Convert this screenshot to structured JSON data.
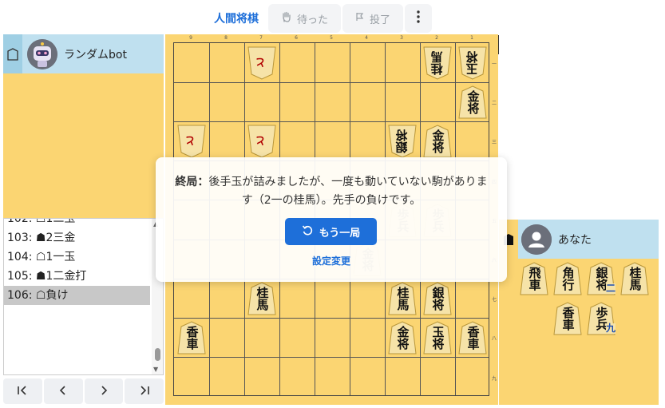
{
  "header": {
    "mode_title": "人間将棋",
    "undo_label": "待った",
    "resign_label": "投了",
    "menu_icon": "more-vertical-icon"
  },
  "opponent": {
    "name": "ランダムbot",
    "turn_icon": "gote-turn-icon",
    "avatar_icon": "robot-avatar-icon"
  },
  "player": {
    "name": "あなた",
    "turn_icon": "sente-turn-icon",
    "avatar_icon": "user-avatar-icon"
  },
  "moves": [
    {
      "label": "102: ☖1二玉"
    },
    {
      "label": "103: ☗2三金"
    },
    {
      "label": "104: ☖1一玉"
    },
    {
      "label": "105: ☗1二金打"
    },
    {
      "label": "106: ☖負け"
    }
  ],
  "selected_move_index": 4,
  "nav": {
    "first": "|<",
    "prev": "<",
    "next": ">",
    "last": ">|"
  },
  "board": {
    "files": [
      "9",
      "8",
      "7",
      "6",
      "5",
      "4",
      "3",
      "2",
      "1"
    ],
    "ranks": [
      "一",
      "二",
      "三",
      "四",
      "五",
      "六",
      "七",
      "八",
      "九"
    ],
    "pieces": [
      {
        "file": 7,
        "rank": 1,
        "kanji": "と",
        "owner": "gote",
        "promoted": true
      },
      {
        "file": 2,
        "rank": 1,
        "kanji": "桂馬",
        "owner": "gote"
      },
      {
        "file": 1,
        "rank": 1,
        "kanji": "玉将",
        "owner": "gote"
      },
      {
        "file": 1,
        "rank": 2,
        "kanji": "金将",
        "owner": "sente"
      },
      {
        "file": 9,
        "rank": 3,
        "kanji": "と",
        "owner": "gote",
        "promoted": true
      },
      {
        "file": 7,
        "rank": 3,
        "kanji": "と",
        "owner": "gote",
        "promoted": true
      },
      {
        "file": 3,
        "rank": 3,
        "kanji": "銀将",
        "owner": "gote"
      },
      {
        "file": 2,
        "rank": 3,
        "kanji": "金将",
        "owner": "sente"
      },
      {
        "file": 3,
        "rank": 5,
        "kanji": "歩兵",
        "owner": "sente",
        "faded": true
      },
      {
        "file": 2,
        "rank": 5,
        "kanji": "歩兵",
        "owner": "sente",
        "faded": true
      },
      {
        "file": 4,
        "rank": 6,
        "kanji": "金将",
        "owner": "sente",
        "faded": true
      },
      {
        "file": 7,
        "rank": 7,
        "kanji": "桂馬",
        "owner": "sente"
      },
      {
        "file": 3,
        "rank": 7,
        "kanji": "桂馬",
        "owner": "sente"
      },
      {
        "file": 2,
        "rank": 7,
        "kanji": "銀将",
        "owner": "sente"
      },
      {
        "file": 9,
        "rank": 8,
        "kanji": "香車",
        "owner": "sente"
      },
      {
        "file": 3,
        "rank": 8,
        "kanji": "金将",
        "owner": "sente"
      },
      {
        "file": 2,
        "rank": 8,
        "kanji": "玉将",
        "owner": "sente"
      },
      {
        "file": 1,
        "rank": 8,
        "kanji": "香車",
        "owner": "sente"
      }
    ]
  },
  "hand": [
    {
      "kanji": "飛車",
      "count": ""
    },
    {
      "kanji": "角行",
      "count": ""
    },
    {
      "kanji": "銀将",
      "count": "二"
    },
    {
      "kanji": "桂馬",
      "count": ""
    },
    {
      "kanji": "香車",
      "count": ""
    },
    {
      "kanji": "歩兵",
      "count": "九"
    }
  ],
  "modal": {
    "title": "終局：",
    "message": "後手玉が詰みましたが、一度も動いていない駒があります（2一の桂馬）。先手の負けです。",
    "again_label": "もう一局",
    "settings_label": "設定変更"
  },
  "colors": {
    "accent": "#1e6fd9",
    "board": "#fbd572",
    "player_bar": "#bfe0ef"
  }
}
